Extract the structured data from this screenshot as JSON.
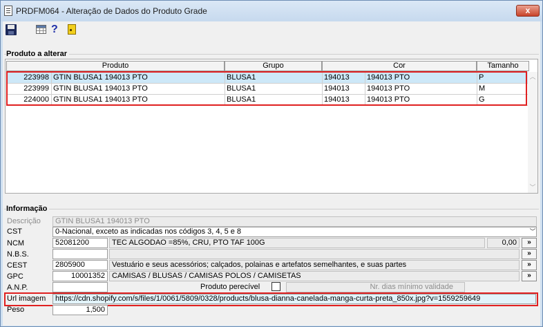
{
  "window": {
    "title": "PRDFM064 - Alteração de Dados do Produto Grade",
    "close_glyph": "x"
  },
  "toolbar": {
    "icons": [
      "save-icon",
      "grid-icon",
      "help-icon",
      "exit-icon"
    ],
    "help_glyph": "?"
  },
  "produtos": {
    "section_title": "Produto a alterar",
    "columns": [
      "Produto",
      "Grupo",
      "Cor",
      "Tamanho"
    ],
    "rows": [
      {
        "codigo": "223998",
        "produto": "GTIN BLUSA1 194013 PTO",
        "grupo": "BLUSA1",
        "cor_codigo": "194013",
        "cor": "194013 PTO",
        "tamanho": "P"
      },
      {
        "codigo": "223999",
        "produto": "GTIN BLUSA1 194013 PTO",
        "grupo": "BLUSA1",
        "cor_codigo": "194013",
        "cor": "194013 PTO",
        "tamanho": "M"
      },
      {
        "codigo": "224000",
        "produto": "GTIN BLUSA1 194013 PTO",
        "grupo": "BLUSA1",
        "cor_codigo": "194013",
        "cor": "194013 PTO",
        "tamanho": "G"
      }
    ],
    "selected_row": 0
  },
  "informacao": {
    "section_title": "Informação",
    "descricao_label": "Descrição",
    "descricao_value": "GTIN BLUSA1 194013 PTO",
    "cst_label": "CST",
    "cst_value": "0-Nacional, exceto as indicadas nos códigos 3, 4, 5 e 8",
    "ncm_label": "NCM",
    "ncm_value": "52081200",
    "ncm_desc": "TEC ALGODAO  =85%, CRU, PTO TAF 100G",
    "ncm_aliquota": "0,00",
    "nbs_label": "N.B.S.",
    "nbs_value": "",
    "cest_label": "CEST",
    "cest_value": "2805900",
    "cest_desc": "Vestuário e seus acessórios; calçados, polainas e artefatos semelhantes, e suas partes",
    "gpc_label": "GPC",
    "gpc_value": "10001352",
    "gpc_desc": "CAMISAS / BLUSAS / CAMISAS POLOS / CAMISETAS",
    "anp_label": "A.N.P.",
    "anp_value": "",
    "perecivel_label": "Produto perecível",
    "validade_label": "Nr. dias mínimo validade",
    "url_label": "Url imagem",
    "url_value": "https://cdn.shopify.com/s/files/1/0061/5809/0328/products/blusa-dianna-canelada-manga-curta-preta_850x.jpg?v=1559259649",
    "peso_label": "Peso",
    "peso_value": "1,500",
    "lookup_glyph": "»"
  },
  "colors": {
    "selected_row": "#cde8f8",
    "highlight_box": "#e02020"
  }
}
